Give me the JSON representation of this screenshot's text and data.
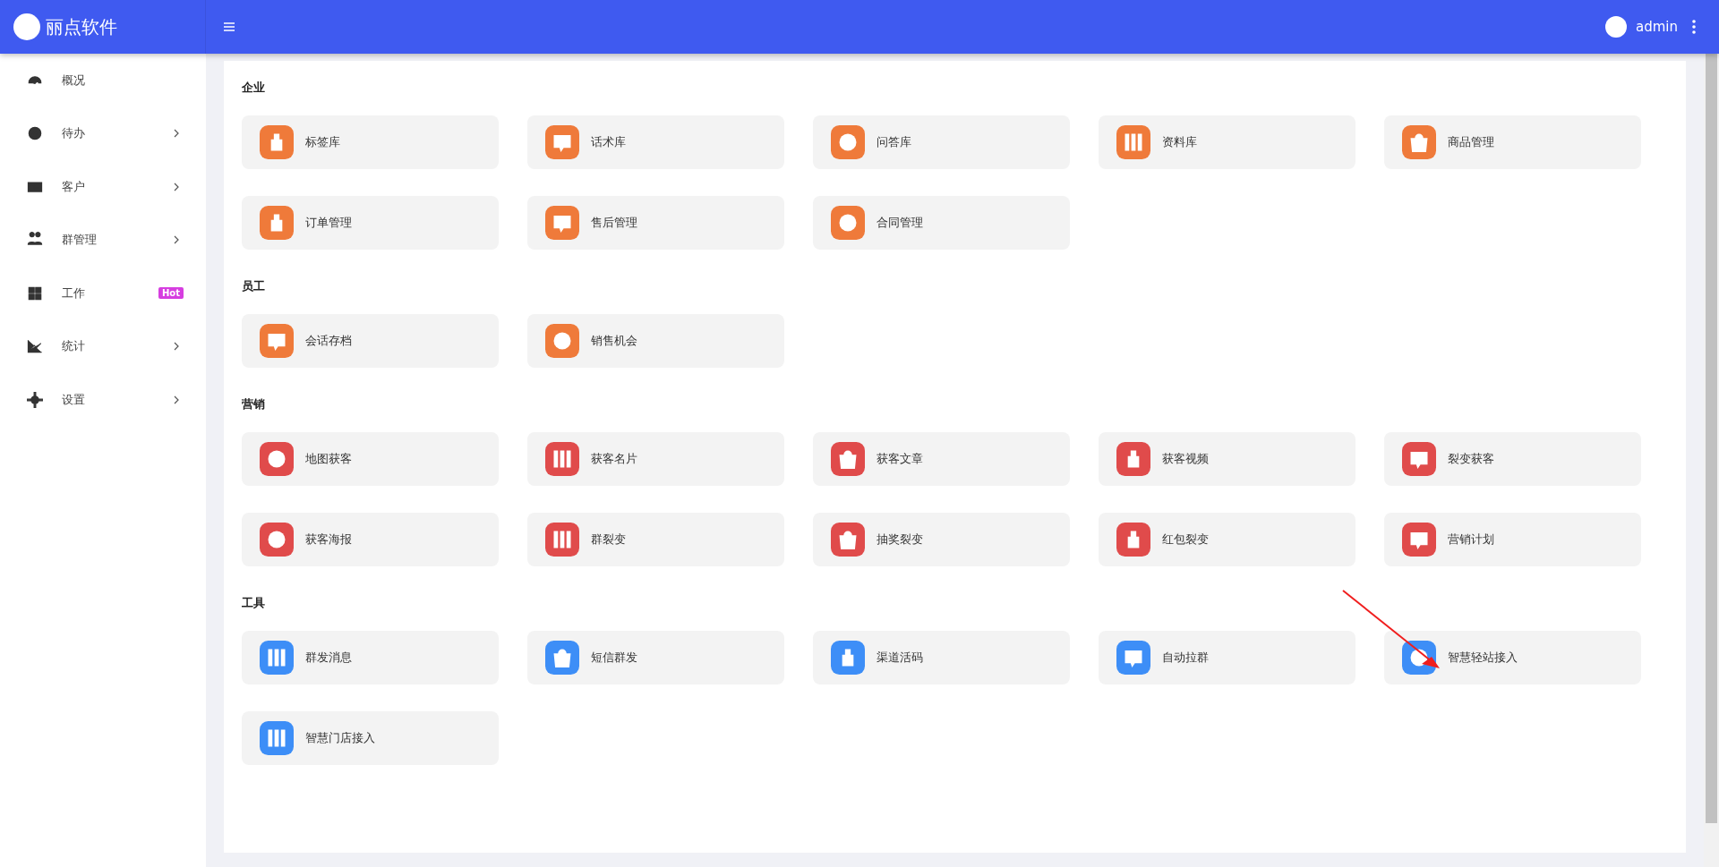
{
  "header": {
    "brand": "丽点软件",
    "user": "admin"
  },
  "sidebar": {
    "items": [
      {
        "label": "概况",
        "expandable": false
      },
      {
        "label": "待办",
        "expandable": true
      },
      {
        "label": "客户",
        "expandable": true
      },
      {
        "label": "群管理",
        "expandable": true
      },
      {
        "label": "工作",
        "expandable": false,
        "badge": "Hot"
      },
      {
        "label": "统计",
        "expandable": true
      },
      {
        "label": "设置",
        "expandable": true
      }
    ]
  },
  "sections": [
    {
      "title": "企业",
      "color": "#ef7a3a",
      "tiles": [
        "标签库",
        "话术库",
        "问答库",
        "资料库",
        "商品管理",
        "订单管理",
        "售后管理",
        "合同管理"
      ]
    },
    {
      "title": "员工",
      "color": "#ef7a3a",
      "tiles": [
        "会话存档",
        "销售机会"
      ]
    },
    {
      "title": "营销",
      "color": "#e04b4b",
      "tiles": [
        "地图获客",
        "获客名片",
        "获客文章",
        "获客视频",
        "裂变获客",
        "获客海报",
        "群裂变",
        "抽奖裂变",
        "红包裂变",
        "营销计划"
      ]
    },
    {
      "title": "工具",
      "color": "#3d8ef7",
      "tiles": [
        "群发消息",
        "短信群发",
        "渠道活码",
        "自动拉群",
        "智慧轻站接入",
        "智慧门店接入"
      ]
    }
  ]
}
